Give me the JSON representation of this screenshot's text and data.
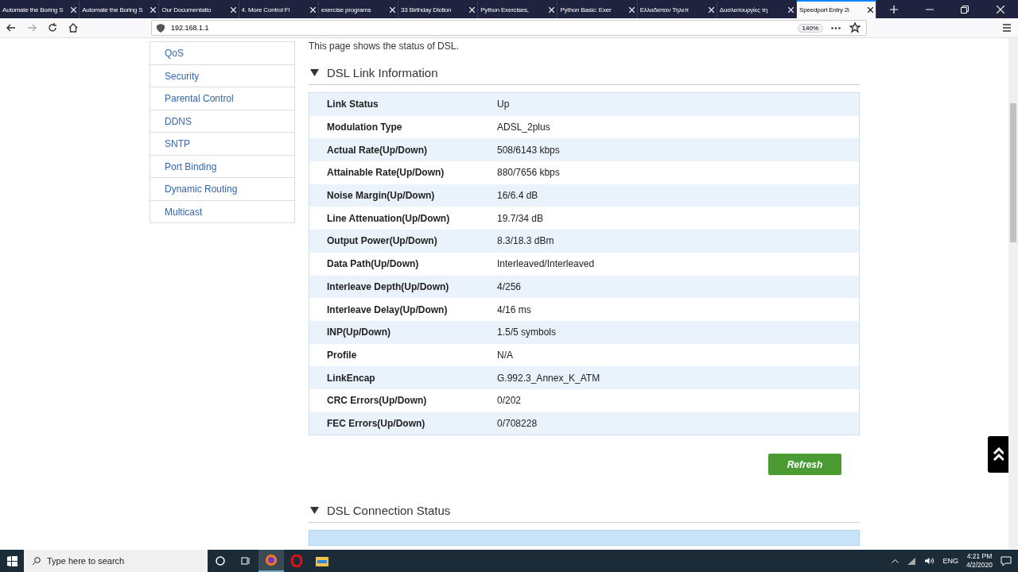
{
  "browser": {
    "tabs": [
      {
        "title": "Automate the Boring S",
        "selected": false
      },
      {
        "title": "Automate the Boring S",
        "selected": false
      },
      {
        "title": "Our Documentatio",
        "selected": false
      },
      {
        "title": "4. More Control Fl",
        "selected": false
      },
      {
        "title": "exercise programs",
        "selected": false
      },
      {
        "title": "33 Birthday Diction",
        "selected": false
      },
      {
        "title": "Python Exercises,",
        "selected": false
      },
      {
        "title": "Python Basic: Exer",
        "selected": false
      },
      {
        "title": "Ελλαδισταν Τηλεπ",
        "selected": false
      },
      {
        "title": "Δυσλειτουργίες τη",
        "selected": false
      },
      {
        "title": "Speedport Entry 2i",
        "selected": true
      }
    ],
    "address": "192.168.1.1",
    "zoom": "140%"
  },
  "sidebar": {
    "items": [
      "QoS",
      "Security",
      "Parental Control",
      "DDNS",
      "SNTP",
      "Port Binding",
      "Dynamic Routing",
      "Multicast"
    ]
  },
  "intro": "This page shows the status of DSL.",
  "sections": [
    {
      "title": "DSL Link Information",
      "expanded": true,
      "rows": [
        {
          "label": "Link Status",
          "value": "Up"
        },
        {
          "label": "Modulation Type",
          "value": "ADSL_2plus"
        },
        {
          "label": "Actual Rate(Up/Down)",
          "value": "508/6143 kbps"
        },
        {
          "label": "Attainable Rate(Up/Down)",
          "value": "880/7656 kbps"
        },
        {
          "label": "Noise Margin(Up/Down)",
          "value": "16/6.4 dB"
        },
        {
          "label": "Line Attenuation(Up/Down)",
          "value": "19.7/34 dB"
        },
        {
          "label": "Output Power(Up/Down)",
          "value": "8.3/18.3 dBm"
        },
        {
          "label": "Data Path(Up/Down)",
          "value": "Interleaved/Interleaved"
        },
        {
          "label": "Interleave Depth(Up/Down)",
          "value": "4/256"
        },
        {
          "label": "Interleave Delay(Up/Down)",
          "value": "4/16 ms"
        },
        {
          "label": "INP(Up/Down)",
          "value": "1.5/5 symbols"
        },
        {
          "label": "Profile",
          "value": "N/A"
        },
        {
          "label": "LinkEncap",
          "value": "G.992.3_Annex_K_ATM"
        },
        {
          "label": "CRC Errors(Up/Down)",
          "value": "0/202"
        },
        {
          "label": "FEC Errors(Up/Down)",
          "value": "0/708228"
        }
      ],
      "button": "Refresh"
    },
    {
      "title": "DSL Connection Status",
      "expanded": true
    }
  ],
  "taskbar": {
    "search_placeholder": "Type here to search",
    "language": "ENG",
    "time": "4:21 PM",
    "date": "4/2/2020"
  }
}
